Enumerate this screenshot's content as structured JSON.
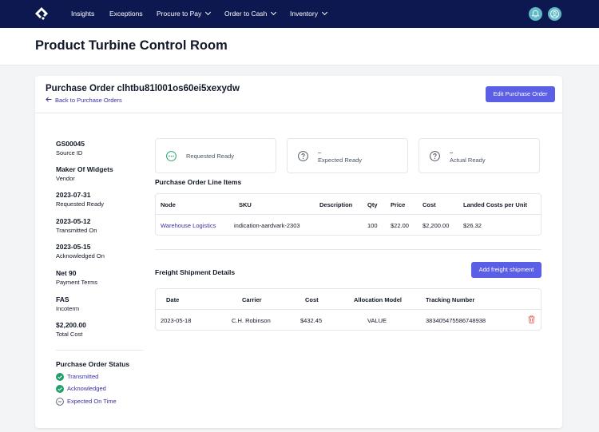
{
  "nav": {
    "items": [
      "Insights",
      "Exceptions",
      "Procure to Pay",
      "Order to Cash",
      "Inventory"
    ]
  },
  "header": {
    "title": "Product Turbine Control Room"
  },
  "po": {
    "title": "Purchase Order clhtbu81l001os60ei5xexydw",
    "back_label": "Back to Purchase Orders",
    "edit_label": "Edit Purchase Order"
  },
  "meta": [
    {
      "value": "GS00045",
      "label": "Source ID"
    },
    {
      "value": "Maker Of Widgets",
      "label": "Vendor"
    },
    {
      "value": "2023-07-31",
      "label": "Requested Ready"
    },
    {
      "value": "2023-05-12",
      "label": "Transmitted On"
    },
    {
      "value": "2023-05-15",
      "label": "Acknowledged On"
    },
    {
      "value": "Net 90",
      "label": "Payment Terms"
    },
    {
      "value": "FAS",
      "label": "Incoterm"
    },
    {
      "value": "$2,200.00",
      "label": "Total Cost"
    }
  ],
  "status": {
    "title": "Purchase Order Status",
    "items": [
      {
        "label": "Transmitted",
        "state": "done"
      },
      {
        "label": "Acknowledged",
        "state": "done"
      },
      {
        "label": "Expected On Time",
        "state": "pending"
      }
    ]
  },
  "ready_boxes": [
    {
      "text": "Requested Ready",
      "icon": "dots-circle-icon"
    },
    {
      "value": "–",
      "text": "Expected Ready",
      "icon": "question-circle-icon"
    },
    {
      "value": "–",
      "text": "Actual Ready",
      "icon": "question-circle-icon"
    }
  ],
  "line_items": {
    "title": "Purchase Order Line Items",
    "headers": [
      "Node",
      "SKU",
      "Description",
      "Qty",
      "Price",
      "Cost",
      "Landed Costs per Unit"
    ],
    "rows": [
      [
        "Warehouse Logistics",
        "indication-aardvark-2303",
        "",
        "100",
        "$22.00",
        "$2,200.00",
        "$26.32"
      ]
    ]
  },
  "freight": {
    "title": "Freight Shipment Details",
    "add_label": "Add freight shipment",
    "headers": [
      "Date",
      "Carrier",
      "Cost",
      "Allocation Model",
      "Tracking Number"
    ],
    "rows": [
      [
        "2023-05-18",
        "C.H. Robinson",
        "$432.45",
        "VALUE",
        "383405475586748938"
      ]
    ]
  },
  "colors": {
    "nav_bg": "#0d1850",
    "accent": "#5b5fe6",
    "link": "#3730a3",
    "success": "#22a06b",
    "danger": "#e5534b",
    "avatar": "#5fb9c7"
  }
}
